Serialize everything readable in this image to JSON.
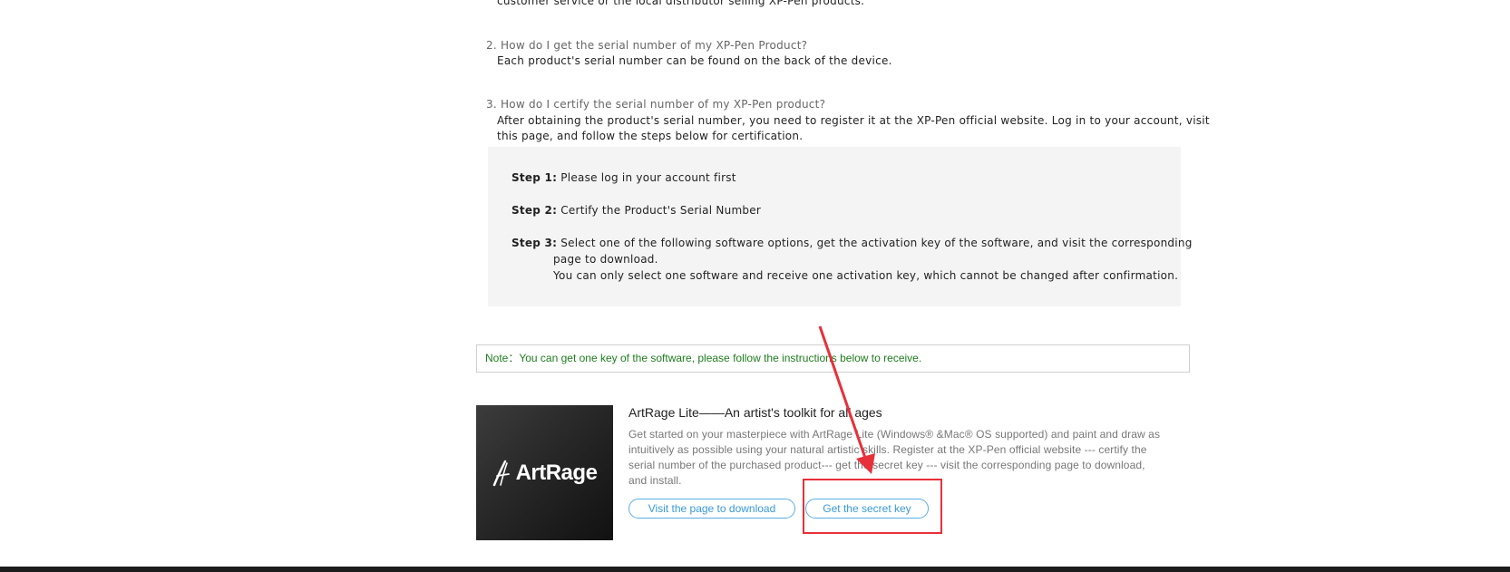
{
  "faq": {
    "prev_answer_tail": "customer service or the local distributor selling XP-Pen products.",
    "q2": "2. How do I get the serial number of my XP-Pen Product?",
    "a2": "Each product's serial number can be found on the back of the device.",
    "q3": "3. How do I certify the serial number of my XP-Pen product?",
    "a3_line1": "After obtaining the product's serial number, you need to register it at the XP-Pen official website. Log in to your account, visit",
    "a3_line2": "this page, and follow the steps below for certification."
  },
  "steps": [
    {
      "label": "Step 1:",
      "text": "Please log in your account first"
    },
    {
      "label": "Step 2:",
      "text": "Certify the Product's Serial Number"
    },
    {
      "label": "Step 3:",
      "text": "Select one of the following software options, get the activation key of the software, and visit the corresponding",
      "text2": "page to download.",
      "text3": "You can only select one software and receive one activation key, which cannot be changed after confirmation."
    }
  ],
  "note": "Note：You can get one key of the software, please follow the instructions below to receive.",
  "product": {
    "logo_text": "ArtRage",
    "title": "ArtRage Lite——An artist's toolkit for all ages",
    "description": "Get started on your masterpiece with ArtRage Lite (Windows® &Mac® OS supported) and paint and draw as intuitively as possible using your natural artistic skills. Register at the XP-Pen official website --- certify the serial number of the purchased product--- get the secret key --- visit the corresponding page to download, and install.",
    "download_button": "Visit the page to download",
    "secret_key_button": "Get the secret key"
  },
  "colors": {
    "note_text": "#1e7d1e",
    "button_border": "#59aee6",
    "annotation_red": "#e8303a"
  }
}
